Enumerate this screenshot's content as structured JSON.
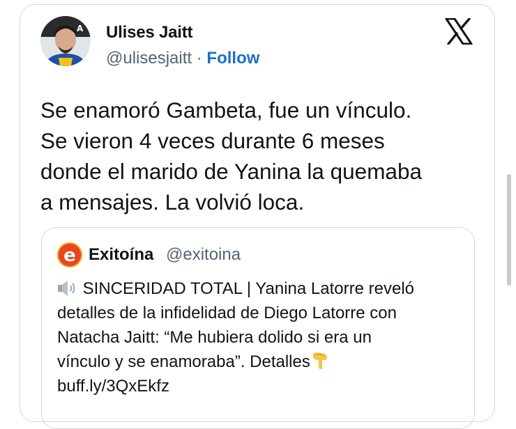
{
  "author": {
    "name": "Ulises Jaitt",
    "handle": "@ulisesjaitt",
    "separator": " · ",
    "follow_label": "Follow"
  },
  "platform_icon": "x-logo-icon",
  "tweet": {
    "lines": [
      "Se enamoró Gambeta, fue un vínculo.",
      "Se vieron 4 veces durante 6 meses",
      "donde el marido de Yanina  la quemaba",
      "a mensajes. La volvió loca."
    ]
  },
  "quoted": {
    "name": "Exitoína",
    "handle": "@exitoina",
    "logo_icon": "exitoina-logo-icon",
    "lines": [
      "SINCERIDAD TOTAL | Yanina Latorre reveló",
      "detalles de la infidelidad de Diego Latorre con",
      "Natacha Jaitt: “Me hubiera dolido si era un",
      "vínculo y se enamoraba”. Detalles",
      "buff.ly/3QxEkfz"
    ],
    "lead_icon": "speaker-icon",
    "trail_icon": "pointing-down-hand-icon"
  },
  "colors": {
    "text": "#0f1419",
    "muted": "#536471",
    "follow": "#1d6fc4",
    "border": "#cfd9de",
    "brand_orange": "#e8461e"
  }
}
